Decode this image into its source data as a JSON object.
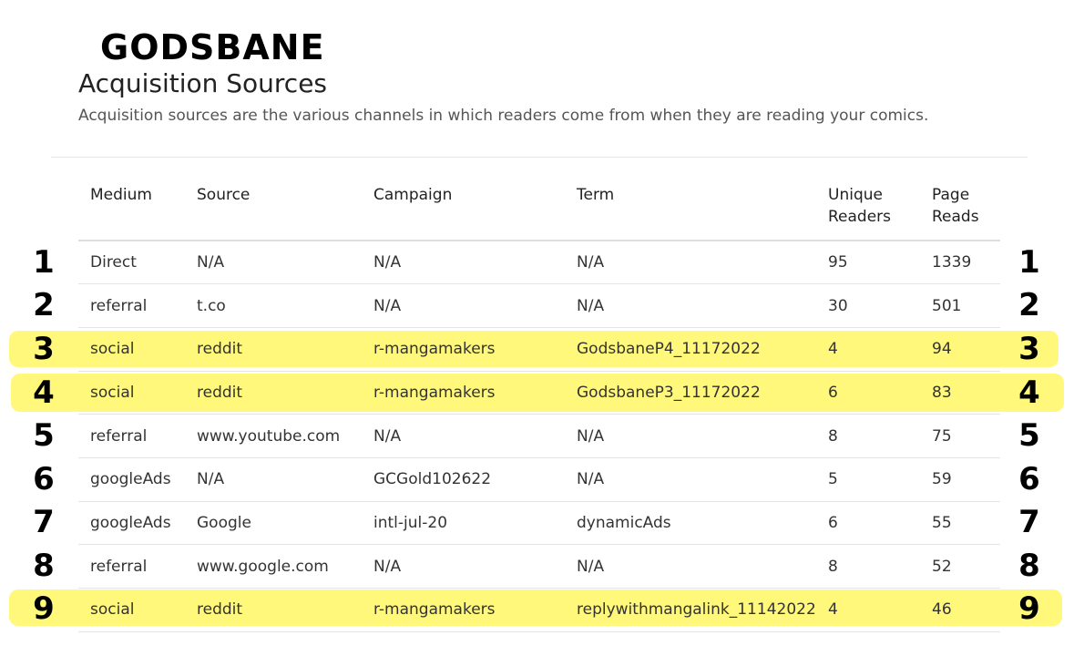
{
  "brand": "GODSBANE",
  "title": "Acquisition Sources",
  "description": "Acquisition sources are the various channels in which readers come from when they are reading your comics.",
  "highlight_color": "#fff87a",
  "table": {
    "headers": {
      "medium": "Medium",
      "source": "Source",
      "campaign": "Campaign",
      "term": "Term",
      "unique_readers_1": "Unique",
      "unique_readers_2": "Readers",
      "page_reads_1": "Page",
      "page_reads_2": "Reads"
    },
    "rows": [
      {
        "num": "1",
        "medium": "Direct",
        "source": "N/A",
        "campaign": "N/A",
        "term": "N/A",
        "unique_readers": "95",
        "page_reads": "1339",
        "highlighted": false
      },
      {
        "num": "2",
        "medium": "referral",
        "source": "t.co",
        "campaign": "N/A",
        "term": "N/A",
        "unique_readers": "30",
        "page_reads": "501",
        "highlighted": false
      },
      {
        "num": "3",
        "medium": "social",
        "source": "reddit",
        "campaign": "r-mangamakers",
        "term": "GodsbaneP4_11172022",
        "unique_readers": "4",
        "page_reads": "94",
        "highlighted": true
      },
      {
        "num": "4",
        "medium": "social",
        "source": "reddit",
        "campaign": "r-mangamakers",
        "term": "GodsbaneP3_11172022",
        "unique_readers": "6",
        "page_reads": "83",
        "highlighted": true
      },
      {
        "num": "5",
        "medium": "referral",
        "source": "www.youtube.com",
        "campaign": "N/A",
        "term": "N/A",
        "unique_readers": "8",
        "page_reads": "75",
        "highlighted": false
      },
      {
        "num": "6",
        "medium": "googleAds",
        "source": "N/A",
        "campaign": "GCGold102622",
        "term": "N/A",
        "unique_readers": "5",
        "page_reads": "59",
        "highlighted": false
      },
      {
        "num": "7",
        "medium": "googleAds",
        "source": "Google",
        "campaign": "intl-jul-20",
        "term": "dynamicAds",
        "unique_readers": "6",
        "page_reads": "55",
        "highlighted": false
      },
      {
        "num": "8",
        "medium": "referral",
        "source": "www.google.com",
        "campaign": "N/A",
        "term": "N/A",
        "unique_readers": "8",
        "page_reads": "52",
        "highlighted": false
      },
      {
        "num": "9",
        "medium": "social",
        "source": "reddit",
        "campaign": "r-mangamakers",
        "term": "replywithmangalink_11142022",
        "unique_readers": "4",
        "page_reads": "46",
        "highlighted": true
      }
    ]
  }
}
